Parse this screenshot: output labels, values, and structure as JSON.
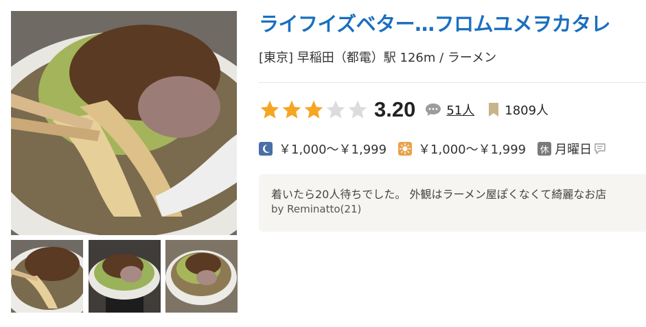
{
  "restaurant": {
    "name": "ライフイズベター…フロムユメヲカタレ",
    "area": "[東京] 早稲田（都電）駅 126m / ラーメン"
  },
  "rating": {
    "stars_filled": 3,
    "stars_total": 5,
    "score": "3.20",
    "review_count": "51人",
    "bookmark_count": "1809人"
  },
  "prices": {
    "dinner": "￥1,000～￥1,999",
    "lunch": "￥1,000～￥1,999",
    "holiday_badge": "休",
    "holiday": "月曜日"
  },
  "review": {
    "excerpt": "着いたら20人待ちでした。 外観はラーメン屋ぽくなくて綺麗なお店",
    "author": "by Reminatto(21)"
  },
  "icons": {
    "star": "star-icon",
    "comment": "comment-icon",
    "bookmark": "bookmark-icon",
    "dinner": "moon-icon",
    "lunch": "sun-icon",
    "holiday": "closed-day-icon",
    "info": "speech-info-icon"
  },
  "colors": {
    "title": "#1a6fbf",
    "star_on": "#f5a623",
    "star_off": "#dcdcdc",
    "dinner_icon_bg": "#4a6ea8",
    "lunch_icon_bg": "#e8a24a",
    "holiday_icon_bg": "#7a7a7a",
    "review_bg": "#f6f5f2"
  }
}
